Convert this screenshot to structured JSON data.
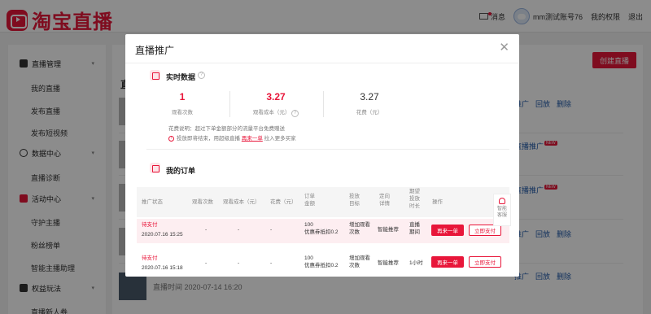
{
  "header": {
    "logo_text": "淘宝直播",
    "messages_label": "消息",
    "account_name": "mm测试账号76",
    "permissions_label": "我的权限",
    "logout_label": "退出"
  },
  "sidebar": {
    "groups": [
      {
        "label": "直播管理",
        "icon": "tv-icon",
        "items": [
          "我的直播",
          "发布直播",
          "发布短视频"
        ]
      },
      {
        "label": "数据中心",
        "icon": "chart-icon",
        "items": [
          "直播诊断"
        ]
      },
      {
        "label": "活动中心",
        "icon": "flag-icon",
        "items": [
          "守护主播",
          "粉丝榜单",
          "智能主播助理"
        ]
      },
      {
        "label": "权益玩法",
        "icon": "gift-icon",
        "items": [
          "直播新人券"
        ]
      }
    ]
  },
  "main": {
    "title": "直播",
    "create_button": "创建直播",
    "row_actions": [
      "推广",
      "回放",
      "删除"
    ],
    "row_actions_promote": [
      "直播推广"
    ],
    "new_badge": "NEW",
    "last_row_time": "直播时间 2020-07-14 16:20"
  },
  "modal": {
    "title": "直播推广",
    "realtime": {
      "title": "实时数据",
      "stats": [
        {
          "value": "1",
          "label": "观看次数"
        },
        {
          "value": "3.27",
          "label": "观看成本（元）"
        },
        {
          "value": "3.27",
          "label": "花费（元）"
        }
      ],
      "fee_note": "花费说明：超过下单金额部分的流量平台免费赠送",
      "tip_prefix": "投放即将结束，用超级直播",
      "tip_link": "再来一单",
      "tip_suffix": "拉入更多买家"
    },
    "orders": {
      "title": "我的订单",
      "columns": [
        "推广状态",
        "观看次数",
        "观看成本（元）",
        "花费（元）",
        "订单\n金额",
        "投放\n目标",
        "定向\n详情",
        "期望\n投放\n时长",
        "操作"
      ],
      "rows": [
        {
          "status": "待支付",
          "time": "2020.07.16 15:25",
          "views": "-",
          "cost": "-",
          "spend": "-",
          "amount": "100\n优惠券抵扣0.2",
          "goal": "增加观看\n次数",
          "targeting": "智能推荐",
          "duration": "直播\n期间",
          "btn_again": "再来一单",
          "btn_pay": "立即支付"
        },
        {
          "status": "待支付",
          "time": "2020.07.16 15:18",
          "views": "-",
          "cost": "-",
          "spend": "-",
          "amount": "100\n优惠券抵扣0.2",
          "goal": "增加观看\n次数",
          "targeting": "智能推荐",
          "duration": "1小时",
          "btn_again": "再来一单",
          "btn_pay": "立即支付"
        }
      ]
    },
    "customer_service": "智能\n客服"
  }
}
